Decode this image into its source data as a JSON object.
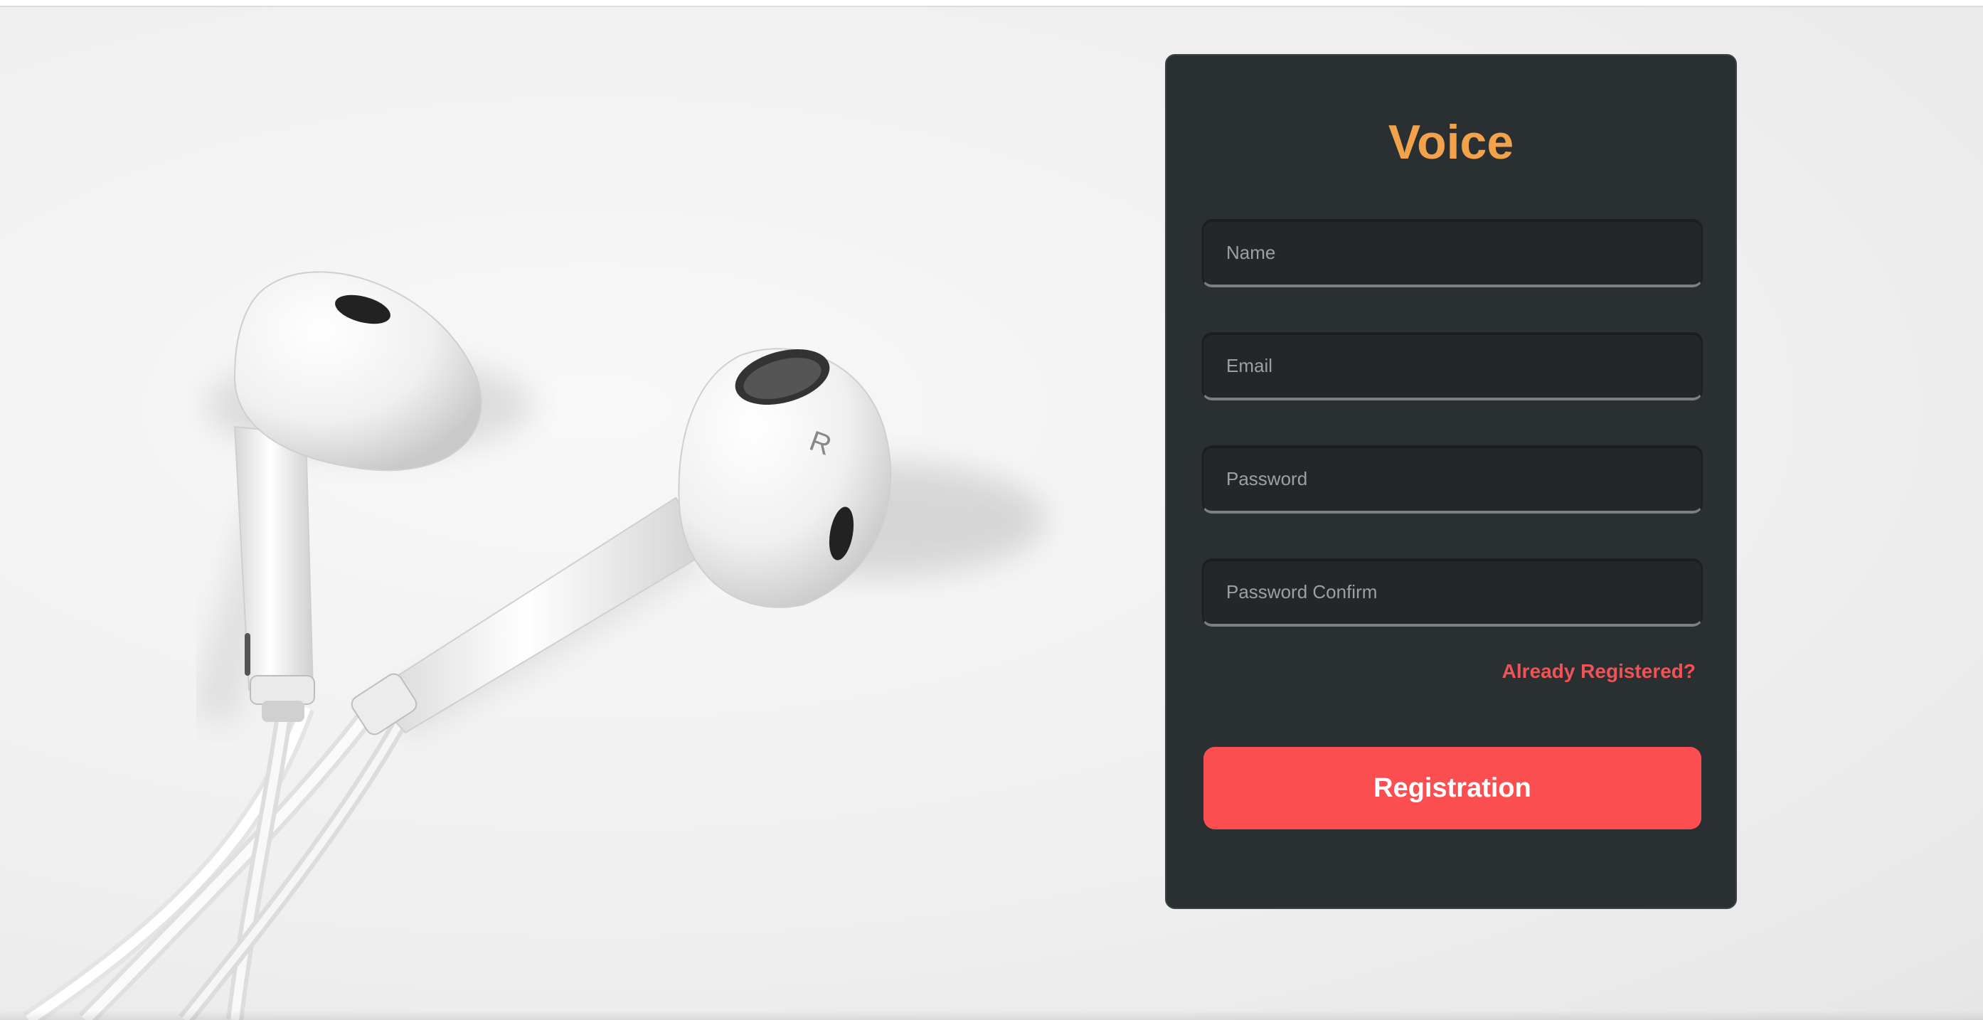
{
  "brand": {
    "title": "Voice",
    "accent_color": "#f2a24a",
    "panel_color": "#2a2f32",
    "button_color": "#fb4e51",
    "link_color": "#f05356"
  },
  "hero": {
    "image": "white-earphones-illustration",
    "earbud_mark": "R"
  },
  "form": {
    "name": {
      "placeholder": "Name",
      "value": ""
    },
    "email": {
      "placeholder": "Email",
      "value": ""
    },
    "password": {
      "placeholder": "Password",
      "value": ""
    },
    "password_confirm": {
      "placeholder": "Password Confirm",
      "value": ""
    },
    "login_link": "Already Registered?",
    "submit_label": "Registration"
  }
}
